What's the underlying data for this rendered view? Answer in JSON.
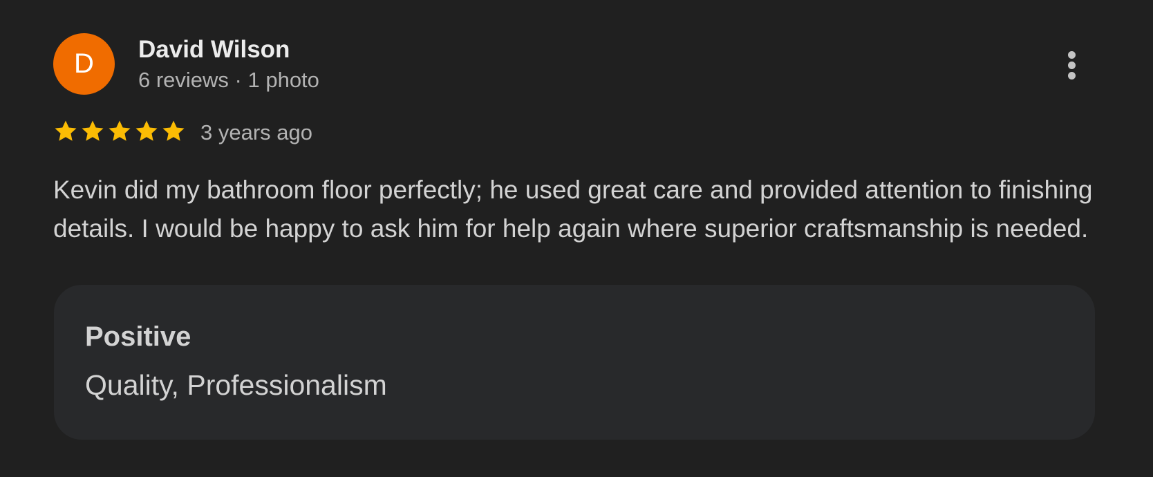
{
  "review": {
    "author": {
      "initial": "D",
      "name": "David Wilson",
      "meta": "6 reviews · 1 photo",
      "avatar_color": "#f06c00"
    },
    "rating": 5,
    "max_rating": 5,
    "star_color": "#fbbc04",
    "star_icon": "star-icon",
    "time": "3 years ago",
    "text": "Kevin did my bathroom floor perfectly; he used great care and provided attention to finishing details. I would be happy to ask him for help again where superior craftsmanship is needed.",
    "attributes": {
      "title": "Positive",
      "values": "Quality, Professionalism"
    },
    "menu_icon": "more-vert-icon"
  }
}
